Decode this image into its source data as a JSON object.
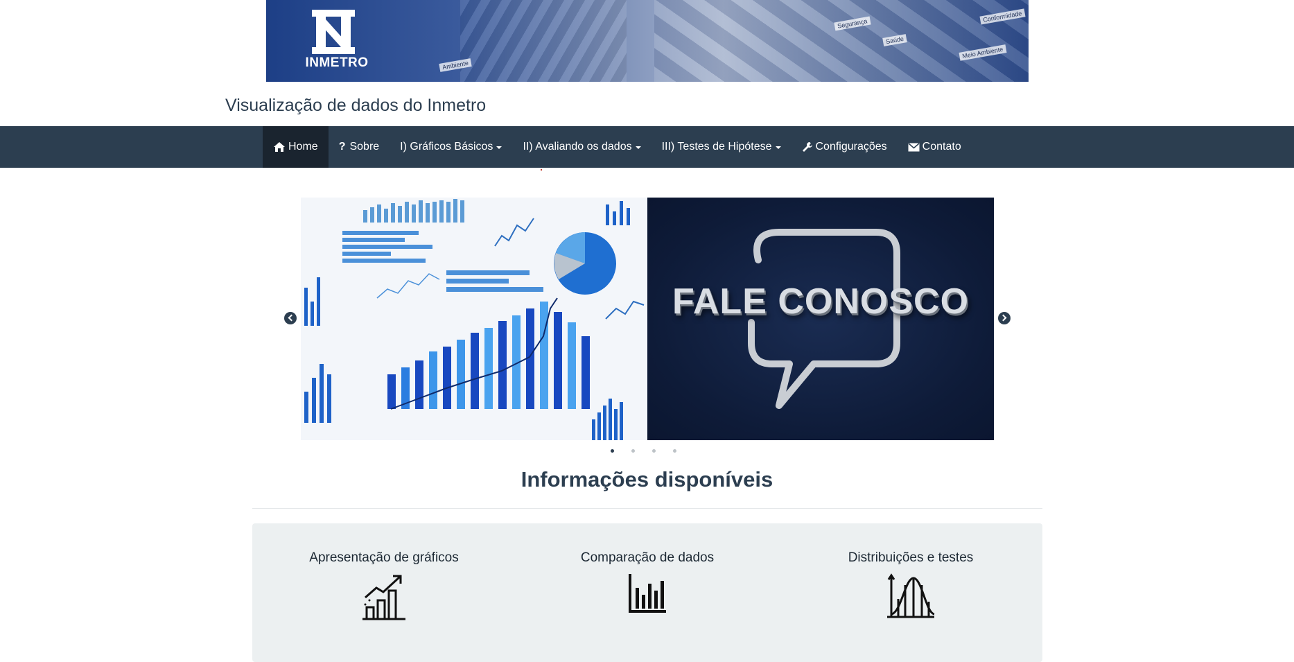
{
  "banner": {
    "logo_text": "INMETRO",
    "tags": [
      "Segurança",
      "Conformidade",
      "Meio Ambiente",
      "Ambiente",
      "Saúde"
    ]
  },
  "site_title": "Visualização de dados do Inmetro",
  "nav": {
    "items": [
      {
        "label": "Home",
        "icon": "home-icon",
        "active": true,
        "dropdown": false
      },
      {
        "label": "Sobre",
        "icon": "question-icon",
        "active": false,
        "dropdown": false
      },
      {
        "label": "I) Gráficos Básicos",
        "active": false,
        "dropdown": true
      },
      {
        "label": "II) Avaliando os dados",
        "active": false,
        "dropdown": true
      },
      {
        "label": "III) Testes de Hipótese",
        "active": false,
        "dropdown": true
      },
      {
        "label": "Configurações",
        "icon": "wrench-icon",
        "active": false,
        "dropdown": false
      },
      {
        "label": "Contato",
        "icon": "envelope-icon",
        "active": false,
        "dropdown": false
      }
    ]
  },
  "carousel": {
    "slide_right_text": "FALE CONOSCO",
    "slide_count": 4,
    "active_slide": 1
  },
  "section_title": "Informações disponíveis",
  "features": [
    {
      "title": "Apresentação de gráficos",
      "icon": "growth-chart-icon"
    },
    {
      "title": "Comparação de dados",
      "icon": "bar-chart-icon"
    },
    {
      "title": "Distribuições e testes",
      "icon": "distribution-curve-icon"
    }
  ],
  "colors": {
    "navbar": "#2c3e50",
    "navbar_active": "#1a242f",
    "panel": "#ecf0f1",
    "text": "#2c3e50"
  }
}
